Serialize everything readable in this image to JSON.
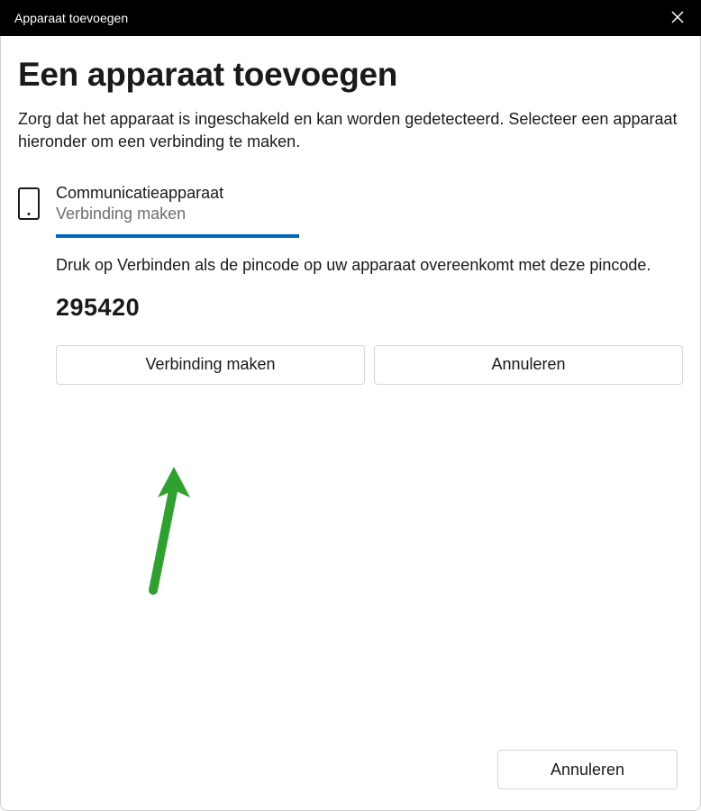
{
  "titlebar": {
    "title": "Apparaat toevoegen"
  },
  "heading": "Een apparaat toevoegen",
  "subtitle": "Zorg dat het apparaat is ingeschakeld en kan worden gedetecteerd. Selecteer een apparaat hieronder om een verbinding te maken.",
  "device": {
    "name": "Communicatieapparaat",
    "status": "Verbinding maken",
    "pin_instruction": "Druk op Verbinden als de pincode op uw apparaat overeenkomt met deze pincode.",
    "pin_code": "295420"
  },
  "buttons": {
    "connect": "Verbinding maken",
    "cancel_inline": "Annuleren",
    "cancel_footer": "Annuleren"
  },
  "colors": {
    "accent": "#0067c0",
    "arrow": "#2fa12f"
  }
}
